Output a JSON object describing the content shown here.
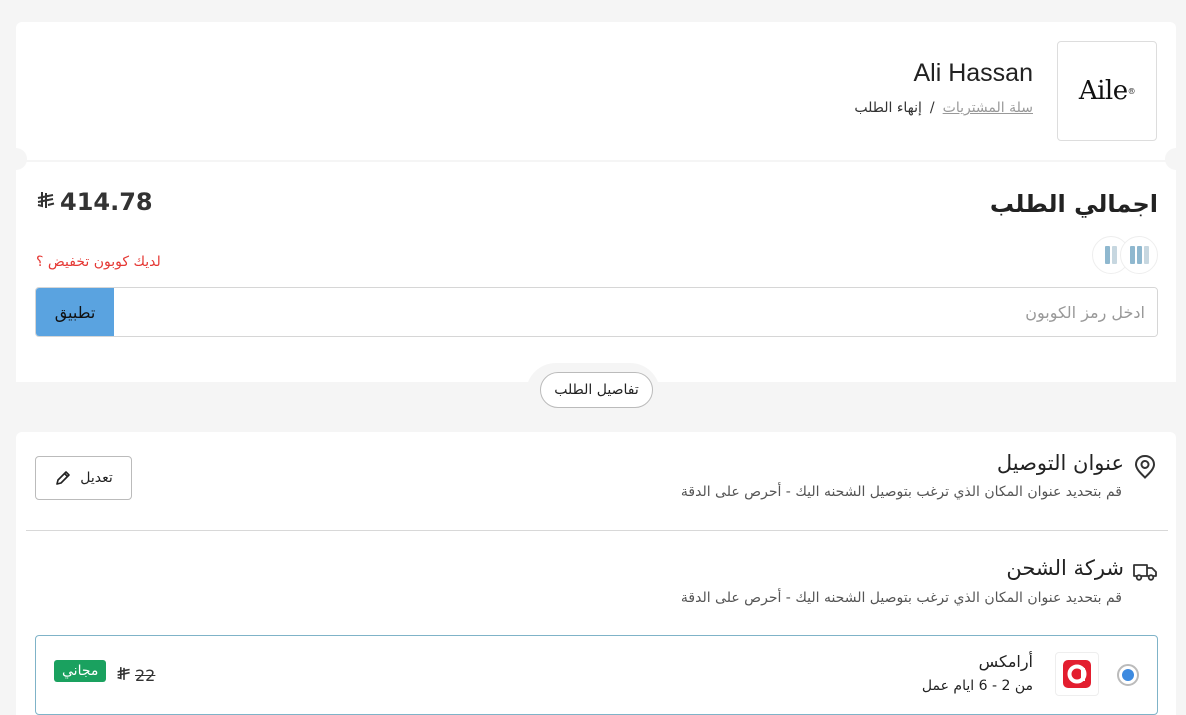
{
  "store": {
    "logo_text": "Aile",
    "name": "Ali Hassan"
  },
  "breadcrumb": {
    "cart": "سلة المشتريات",
    "separator": "/",
    "current": "إنهاء الطلب"
  },
  "summary": {
    "title": "اجمالي الطلب",
    "total": "414.78",
    "currency_symbol": "⃁",
    "coupon_link": "لديك كوبون تخفيض ؟",
    "coupon_placeholder": "ادخل رمز الكوبون",
    "apply_label": "تطبيق",
    "details_label": "تفاصيل الطلب"
  },
  "address": {
    "title": "عنوان التوصيل",
    "description": "قم بتحديد عنوان المكان الذي ترغب بتوصيل الشحنه اليك - أحرص على الدقة",
    "edit_label": "تعديل",
    "icon": "location-pin-icon"
  },
  "shipping": {
    "title": "شركة الشحن",
    "description": "قم بتحديد عنوان المكان الذي ترغب بتوصيل الشحنه اليك - أحرص على الدقة",
    "icon": "truck-icon",
    "options": [
      {
        "name": "أرامكس",
        "eta": "من 2 - 6 ايام عمل",
        "old_price": "22",
        "badge": "مجاني",
        "selected": true,
        "badge_color": "#1aa15f"
      }
    ]
  },
  "colors": {
    "apply_button": "#5aa3e0",
    "coupon_link": "#e53935",
    "radio_selected": "#3d8ae0",
    "carrier_brand": "#e31e2f"
  }
}
